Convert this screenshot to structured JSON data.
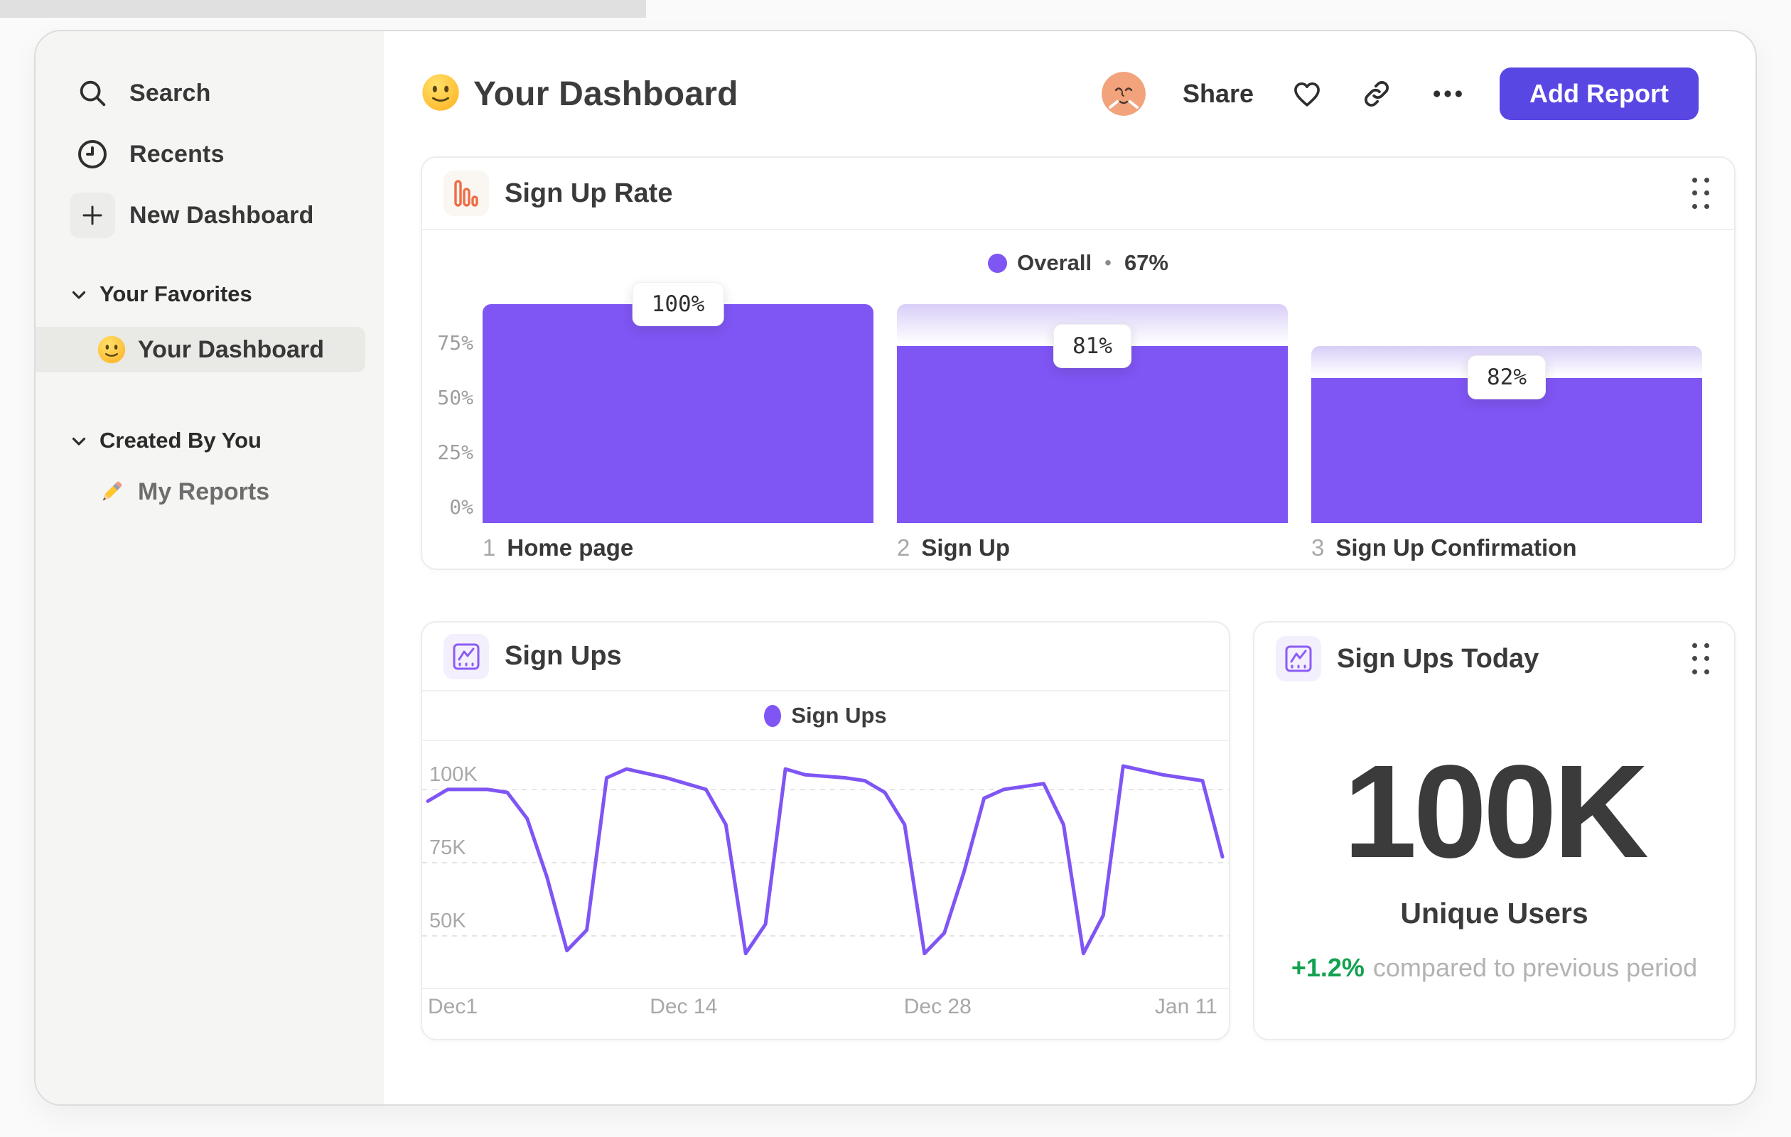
{
  "sidebar": {
    "items": [
      {
        "label": "Search",
        "icon": "search-icon"
      },
      {
        "label": "Recents",
        "icon": "clock-icon"
      },
      {
        "label": "New Dashboard",
        "icon": "plus-icon"
      }
    ],
    "sections": [
      {
        "label": "Your Favorites",
        "items": [
          {
            "label": "Your Dashboard",
            "icon": "smiley-emoji",
            "selected": true
          }
        ]
      },
      {
        "label": "Created By You",
        "items": [
          {
            "label": "My Reports",
            "icon": "pencil-emoji",
            "selected": false
          }
        ]
      }
    ]
  },
  "header": {
    "title": "Your Dashboard",
    "share_label": "Share",
    "add_report_label": "Add Report"
  },
  "colors": {
    "accent_purple": "#7F55F4",
    "button_purple": "#5847E3",
    "positive_green": "#12A150",
    "funnel_icon_orange": "#EE6D45",
    "ghost_gradient_top": "#D9CEF8"
  },
  "chart_data": [
    {
      "id": "sign-up-rate",
      "type": "bar",
      "title": "Sign Up Rate",
      "legend": {
        "label": "Overall",
        "separator": "•",
        "value": "67%"
      },
      "categories": [
        "Home page",
        "Sign Up",
        "Sign Up Confirmation"
      ],
      "step_numbers": [
        "1",
        "2",
        "3"
      ],
      "value_labels": [
        "100%",
        "81%",
        "82%"
      ],
      "values_pct_of_first": [
        100,
        81,
        66.4
      ],
      "prev_pct_of_first": [
        100,
        100,
        81
      ],
      "yticks": [
        {
          "label": "75%",
          "pct": 75
        },
        {
          "label": "50%",
          "pct": 50
        },
        {
          "label": "25%",
          "pct": 25
        },
        {
          "label": "0%",
          "pct": 0
        }
      ],
      "ylim": [
        0,
        100
      ],
      "grid": false,
      "legend_position": "top-center",
      "bar_color": "#7F55F4"
    },
    {
      "id": "sign-ups",
      "type": "line",
      "title": "Sign Ups",
      "legend": {
        "label": "Sign Ups"
      },
      "x_range": [
        "Dec 1",
        "Jan 11"
      ],
      "values_unit": "K users per day",
      "values": [
        96,
        100,
        100,
        100,
        99,
        90,
        70,
        45,
        52,
        104,
        107,
        105.5,
        104,
        102,
        100,
        88,
        44,
        54,
        107,
        105,
        104.5,
        104,
        103,
        99,
        88,
        44,
        51,
        72,
        97,
        100,
        101,
        102,
        88,
        44,
        57,
        108,
        106.5,
        105,
        104,
        103,
        77
      ],
      "yticks": [
        {
          "label": "100K",
          "value": 100
        },
        {
          "label": "75K",
          "value": 75
        },
        {
          "label": "50K",
          "value": 50
        }
      ],
      "xticks": [
        {
          "label": "Dec1",
          "pos": 0.016
        },
        {
          "label": "Dec 14",
          "pos": 0.324
        },
        {
          "label": "Dec 28",
          "pos": 0.639
        },
        {
          "label": "Jan 11",
          "pos": 0.947
        }
      ],
      "value_range": [
        31.8,
        116
      ],
      "grid": "dashed",
      "legend_position": "top-center",
      "line_color": "#7F55F4"
    },
    {
      "id": "sign-ups-today",
      "type": "metric",
      "title": "Sign Ups Today",
      "value": "100K",
      "label": "Unique Users",
      "delta": "+1.2%",
      "delta_suffix": "compared to previous period"
    }
  ]
}
